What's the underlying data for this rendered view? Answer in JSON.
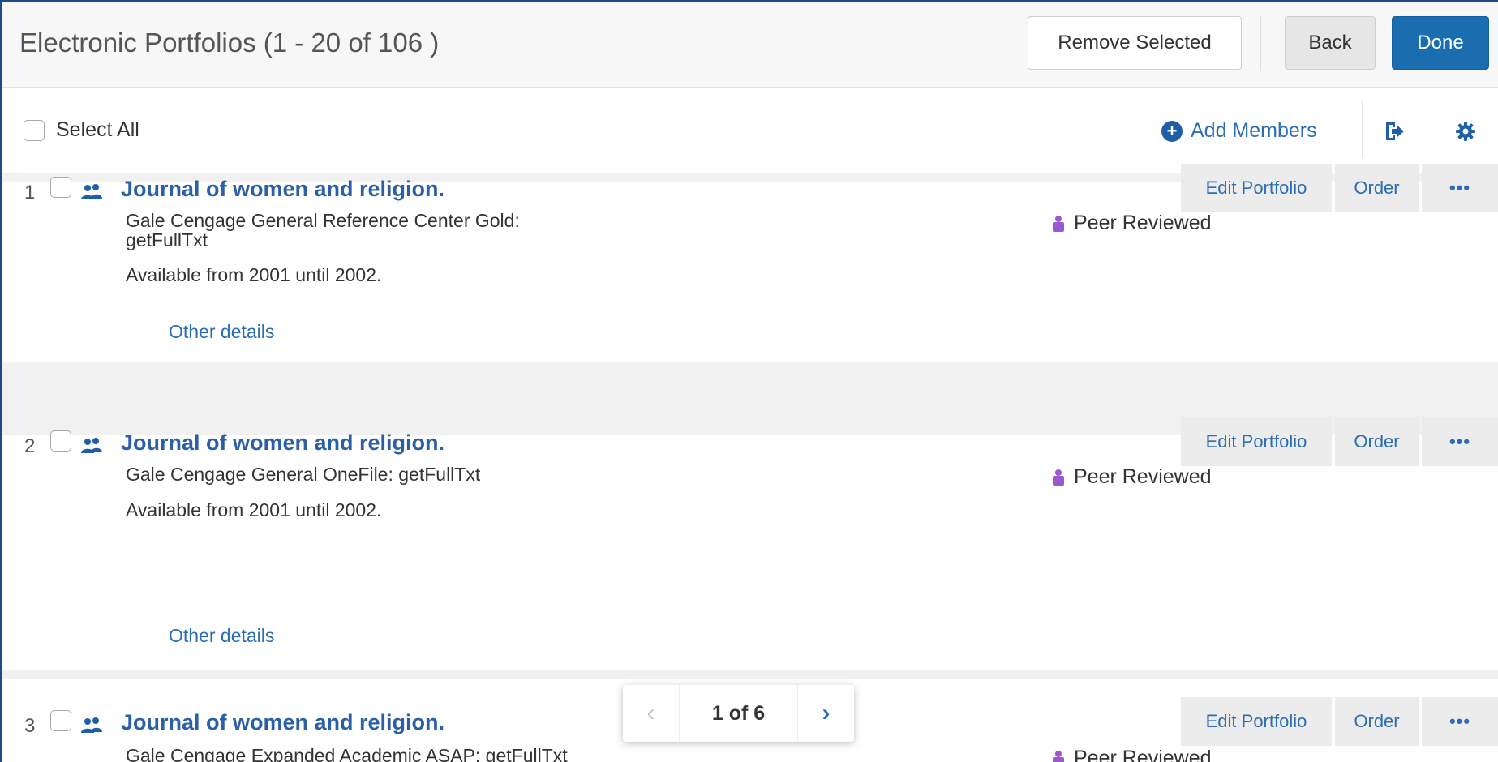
{
  "header": {
    "title": "Electronic Portfolios (1 - 20 of 106 )",
    "remove_selected": "Remove Selected",
    "back": "Back",
    "done": "Done"
  },
  "toolbar": {
    "select_all": "Select All",
    "add_members": "Add Members"
  },
  "items": [
    {
      "number": "1",
      "title": "Journal of women and religion.",
      "line1": "Gale Cengage General Reference Center Gold:",
      "line2": "getFullTxt",
      "availability": "Available from 2001 until 2002.",
      "other_details": "Other details",
      "peer_reviewed": "Peer Reviewed",
      "edit_portfolio": "Edit Portfolio",
      "order": "Order",
      "more": "•••"
    },
    {
      "number": "2",
      "title": "Journal of women and religion.",
      "line1": "Gale Cengage General OneFile: getFullTxt",
      "availability": "Available from 2001 until 2002.",
      "other_details": "Other details",
      "peer_reviewed": "Peer Reviewed",
      "edit_portfolio": "Edit Portfolio",
      "order": "Order",
      "more": "•••"
    },
    {
      "number": "3",
      "title": "Journal of women and religion.",
      "line1": "Gale Cengage Expanded Academic ASAP: getFullTxt",
      "peer_reviewed": "Peer Reviewed",
      "edit_portfolio": "Edit Portfolio",
      "order": "Order",
      "more": "•••"
    }
  ],
  "pagination": {
    "text": "1 of 6",
    "prev": "‹",
    "next": "›"
  },
  "colors": {
    "accent": "#1a6eb0",
    "link": "#2d6db3",
    "peer_icon": "#9b59d0"
  },
  "icons": {
    "owner": "users-icon",
    "export": "export-icon",
    "settings": "gear-icon",
    "add": "plus-circle-icon",
    "peer": "peer-reviewed-icon"
  }
}
